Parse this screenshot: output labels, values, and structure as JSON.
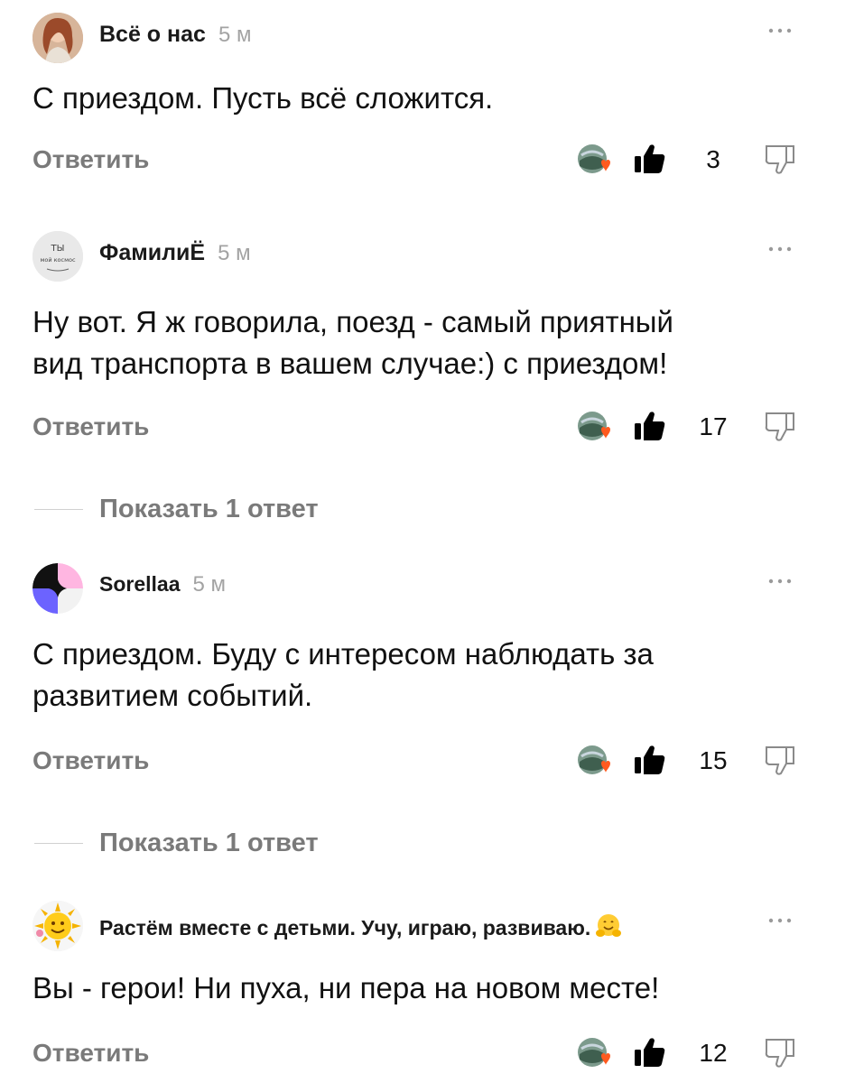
{
  "comments": [
    {
      "author": "Всё о нас",
      "time": "5 м",
      "text": "С приездом. Пусть всё сложится.",
      "reply_label": "Ответить",
      "likes": "3",
      "avatar_icon": "girl-photo-avatar",
      "show_replies": null
    },
    {
      "author": "ФамилиЁ",
      "time": "5 м",
      "text": "Ну вот. Я ж говорила, поезд - самый приятный\nвид транспорта в вашем случае:) с приездом!",
      "reply_label": "Ответить",
      "likes": "17",
      "avatar_icon": "handwritten-note-avatar",
      "avatar_text_1": "ТЫ",
      "avatar_text_2": "мой космос",
      "show_replies": "Показать 1 ответ"
    },
    {
      "author": "Sorellaa",
      "time": "5 м",
      "text": "С приездом. Буду с интересом наблюдать за\nразвитием событий.",
      "reply_label": "Ответить",
      "likes": "15",
      "avatar_icon": "quadrant-logo-avatar",
      "show_replies": "Показать 1 ответ"
    },
    {
      "author": "Растём вместе с детьми. Учу, играю, развиваю.",
      "author_emoji": "hugging-face-emoji",
      "time": "",
      "text": "Вы - герои! Ни пуха, ни пера на новом месте!",
      "reply_label": "Ответить",
      "likes": "12",
      "avatar_icon": "sun-avatar",
      "show_replies": null
    }
  ],
  "colors": {
    "muted": "#7a7a7a",
    "time": "#a3a3a3",
    "heart": "#ff5a1f"
  }
}
